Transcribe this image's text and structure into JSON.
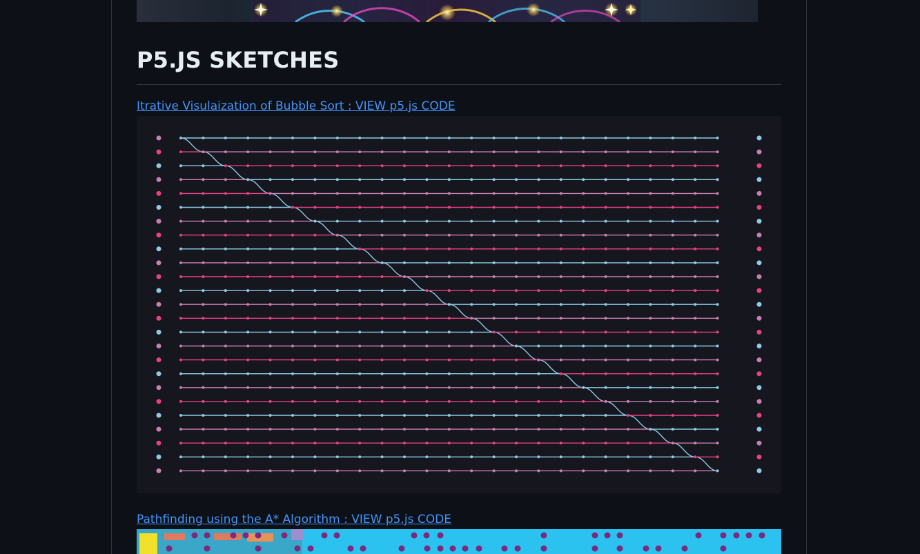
{
  "section": {
    "title": "P5.JS SKETCHES"
  },
  "sketches": [
    {
      "link_text": "Itrative Visulaization of Bubble Sort : VIEW p5.js CODE",
      "image_name": "bubble-sort-visualization"
    },
    {
      "link_text": "Pathfinding using the A* Algorithm : VIEW p5.js CODE",
      "image_name": "astar-pathfinding-visualization"
    }
  ],
  "colors": {
    "page_background": "#0d1117",
    "heading": "#e6edf3",
    "link": "#4493f8",
    "bubble_background": "#16161e",
    "series_pink": "#e8427f",
    "series_mauve": "#c97fb0",
    "series_blue": "#8ecbe6",
    "astar_background": "#2bc2f0",
    "astar_wall": "#7b2a7d"
  }
}
